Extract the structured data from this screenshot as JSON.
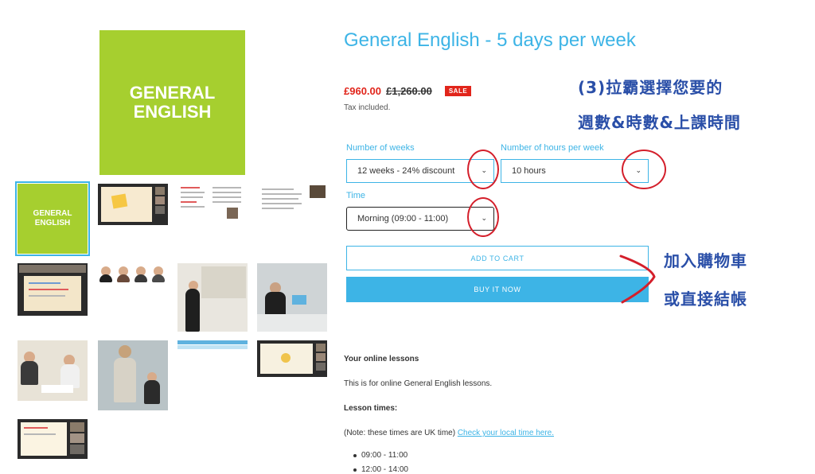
{
  "product": {
    "title": "General English - 5 days per week",
    "sale_price": "£960.00",
    "original_price": "£1,260.00",
    "sale_badge": "SALE",
    "tax_note": "Tax included."
  },
  "gallery": {
    "main_image_text": "GENERAL ENGLISH",
    "thumb_text": "GENERAL ENGLISH"
  },
  "options": {
    "weeks": {
      "label": "Number of weeks",
      "value": "12 weeks - 24% discount"
    },
    "hours": {
      "label": "Number of hours per week",
      "value": "10 hours"
    },
    "time": {
      "label": "Time",
      "value": "Morning (09:00 - 11:00)"
    }
  },
  "buttons": {
    "add_to_cart": "ADD TO CART",
    "buy_now": "BUY IT NOW"
  },
  "annotations": {
    "step3_line1": "(3)拉霸選擇您要的",
    "step3_line2": "週數&時數&上課時間",
    "cart_line1": "加入購物車",
    "cart_line2": "或直接結帳",
    "highlight_color": "#d41f2b",
    "text_color": "#2a4fa8"
  },
  "description": {
    "heading": "Your online lessons",
    "intro": "This is for online General English lessons.",
    "times_heading": "Lesson times:",
    "note_prefix": "(Note: these times are UK time)",
    "note_link": "Check your local time here.",
    "times": [
      "09:00 - 11:00",
      "12:00 - 14:00"
    ]
  },
  "colors": {
    "accent": "#3db4e6",
    "sale": "#e1251b",
    "brand_green": "#a6cf2f"
  }
}
